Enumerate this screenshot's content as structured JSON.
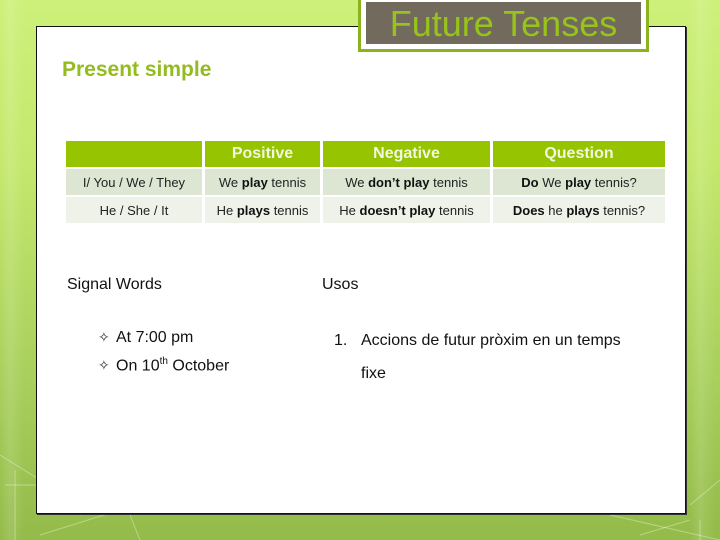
{
  "slide": {
    "title": "Future Tenses",
    "subtitle": "Present simple"
  },
  "table": {
    "headers": [
      "",
      "Positive",
      "Negative",
      "Question"
    ],
    "rows": [
      {
        "subject": "I/ You / We / They",
        "positive": {
          "pre": "We ",
          "bold": "play",
          "post": " tennis"
        },
        "negative": {
          "pre": "We ",
          "bold": "don’t play",
          "post": " tennis"
        },
        "question": {
          "bold1": "Do",
          "mid": " We ",
          "bold2": "play",
          "post": " tennis?"
        }
      },
      {
        "subject": "He / She / It",
        "positive": {
          "pre": "He ",
          "bold": "plays",
          "post": " tennis"
        },
        "negative": {
          "pre": "He ",
          "bold": "doesn’t play",
          "post": " tennis"
        },
        "question": {
          "bold1": "Does",
          "mid": " he ",
          "bold2": "plays",
          "post": " tennis?"
        }
      }
    ]
  },
  "signal_words": {
    "heading": "Signal Words",
    "bullet_icon": "✧",
    "items": [
      {
        "text": "At 7:00 pm",
        "sup": "",
        "tail": ""
      },
      {
        "text": "On 10",
        "sup": "th",
        "tail": " October"
      }
    ]
  },
  "uses": {
    "heading": "Usos",
    "items": [
      {
        "num": "1.",
        "line1": "Accions de futur pròxim en un temps",
        "line2": "fixe"
      }
    ]
  },
  "colors": {
    "accent_green": "#96c400",
    "title_box_bg": "#726a5c",
    "title_text": "#97c41a",
    "subtitle_text": "#94bb1f"
  }
}
